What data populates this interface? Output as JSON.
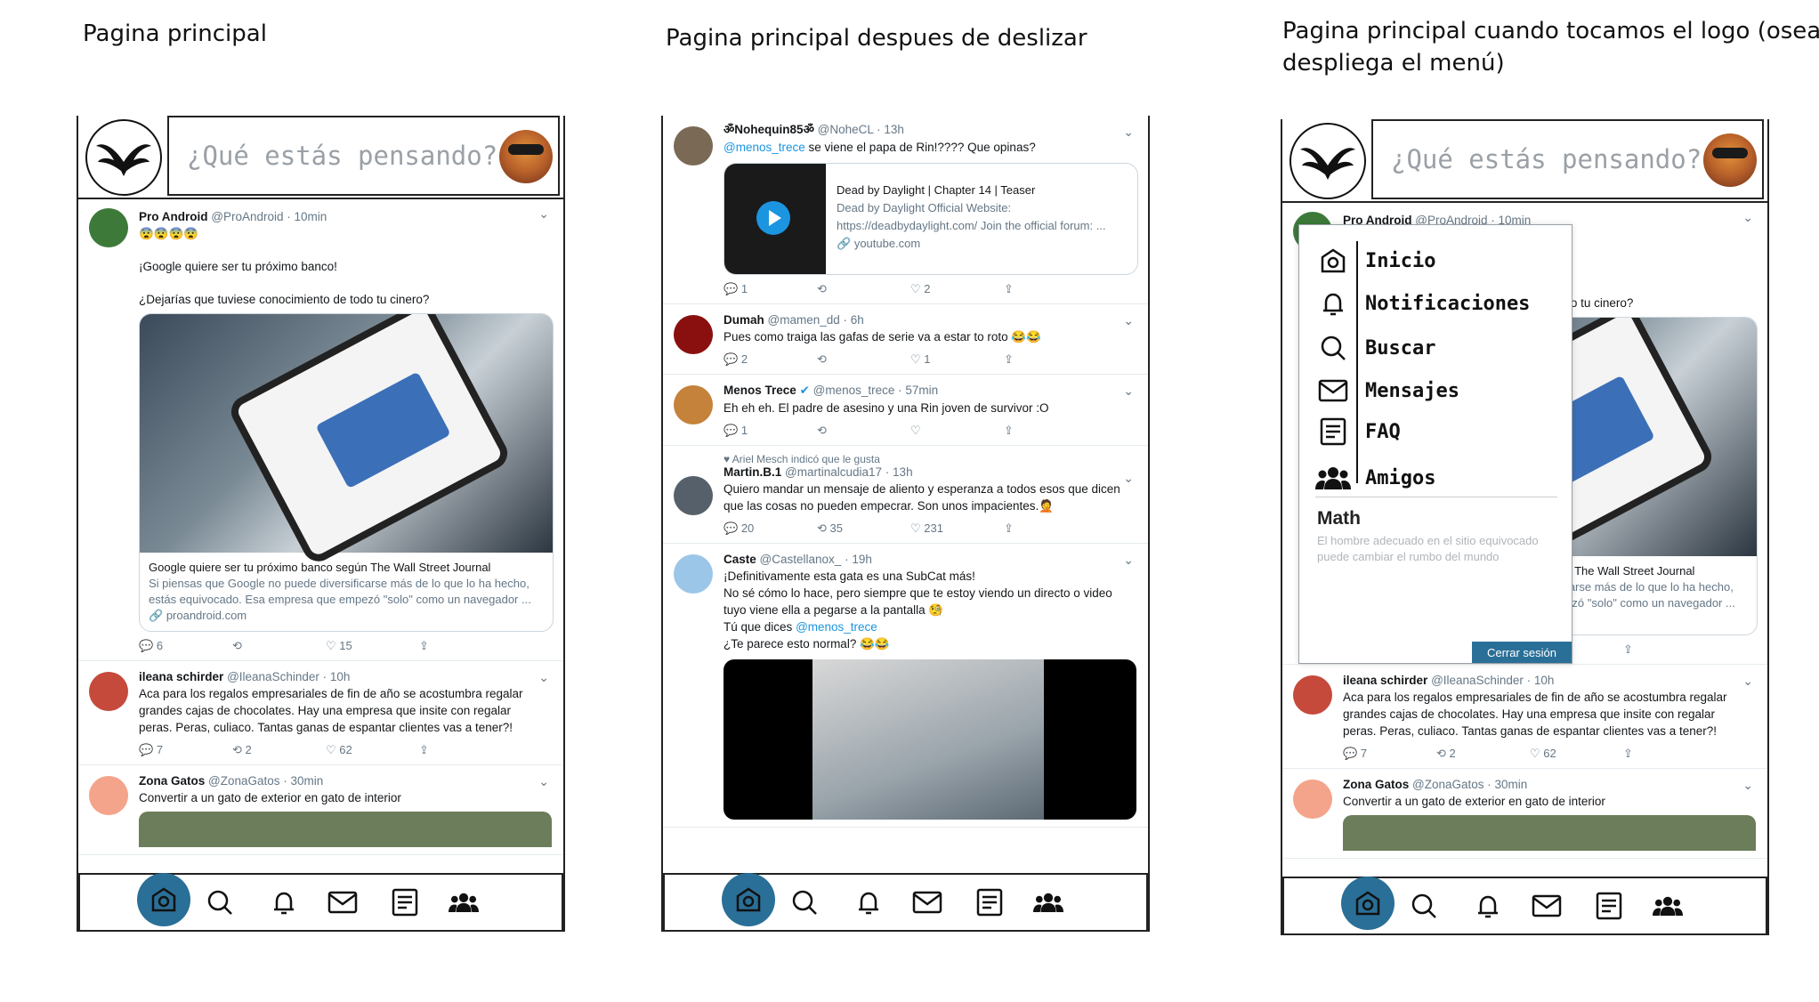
{
  "titles": {
    "screen1": "Pagina principal",
    "screen2": "Pagina principal despues de deslizar",
    "screen3_line1": "Pagina principal cuando tocamos el logo (osea, se",
    "screen3_line2": "despliega el menú)"
  },
  "compose": {
    "placeholder": "¿Qué estás pensando?"
  },
  "feed1": [
    {
      "name": "Pro Android",
      "handle": "@ProAndroid",
      "time": "10min",
      "emoji": "😨😨😨😨",
      "text1": "¡Google quiere ser tu próximo banco!",
      "text2": "¿Dejarías que tuviese conocimiento de todo tu cinero?",
      "card_title": "Google quiere ser tu próximo banco según The Wall Street Journal",
      "card_desc": "Si piensas que Google no puede diversificarse más de lo que lo ha hecho, estás equivocado. Esa empresa que empezó \"solo\" como un navegador ...",
      "card_domain": "proandroid.com",
      "replies": "6",
      "retweets": "",
      "likes": "15"
    },
    {
      "name": "ileana schirder",
      "handle": "@IleanaSchinder",
      "time": "10h",
      "text": "Aca para los regalos empresariales de fin de año se acostumbra regalar grandes cajas de chocolates. Hay una empresa que insite con regalar peras. Peras, culiaco. Tantas ganas de espantar clientes vas a tener?!",
      "replies": "7",
      "retweets": "2",
      "likes": "62"
    },
    {
      "name": "Zona Gatos",
      "handle": "@ZonaGatos",
      "time": "30min",
      "text": "Convertir a un gato de exterior en gato de interior"
    }
  ],
  "feed2": [
    {
      "name": "ॐNohequin85ॐ",
      "handle": "@NoheCL",
      "time": "13h",
      "mention": "@menos_trece",
      "text": "se viene el papa de Rin!???? Que opinas?",
      "card_title": "Dead by Daylight | Chapter 14 | Teaser",
      "card_site": "Dead by Daylight Official Website:",
      "card_url": "https://deadbydaylight.com/ Join the official forum: ...",
      "card_domain": "youtube.com",
      "replies": "1",
      "likes": "2"
    },
    {
      "name": "Dumah",
      "handle": "@mamen_dd",
      "time": "6h",
      "text": "Pues como traiga las gafas de serie va a estar to roto 😂😂",
      "replies": "2",
      "likes": "1"
    },
    {
      "name": "Menos Trece",
      "handle": "@menos_trece",
      "time": "57min",
      "text": "Eh eh eh. El padre de asesino y una Rin joven de survivor :O",
      "replies": "1"
    },
    {
      "liked_note": "Ariel Mesch indicó que le gusta",
      "name": "Martin.B.1",
      "handle": "@martinalcudia17",
      "time": "13h",
      "text": "Quiero mandar un mensaje de aliento y esperanza a todos esos que dicen que las cosas no pueden empecrar. Son unos impacientes.🤦",
      "replies": "20",
      "retweets": "35",
      "likes": "231"
    },
    {
      "name": "Caste",
      "handle": "@Castellanox_",
      "time": "19h",
      "line1": "¡Definitivamente esta gata es una SubCat más!",
      "line2": "No sé cómo lo hace, pero siempre que te estoy viendo un directo o video tuyo viene ella a pegarse a la pantalla 🧐",
      "line3": "Tú que dices",
      "mention": "@menos_trece",
      "line4": "¿Te parece esto normal? 😂😂"
    }
  ],
  "menu": {
    "items": [
      "Inicio",
      "Notificaciones",
      "Buscar",
      "Mensajes",
      "FAQ",
      "Amigos"
    ],
    "user": "Math",
    "bio": "El hombre adecuado en el sitio equivocado puede cambiar el rumbo del mundo",
    "logout": "Cerrar sesión"
  },
  "icons": [
    "home-icon",
    "search-icon",
    "bell-icon",
    "mail-icon",
    "document-icon",
    "friends-icon"
  ],
  "colors": {
    "accent": "#2a6f97",
    "link": "#1b95e0",
    "muted": "#657786"
  }
}
